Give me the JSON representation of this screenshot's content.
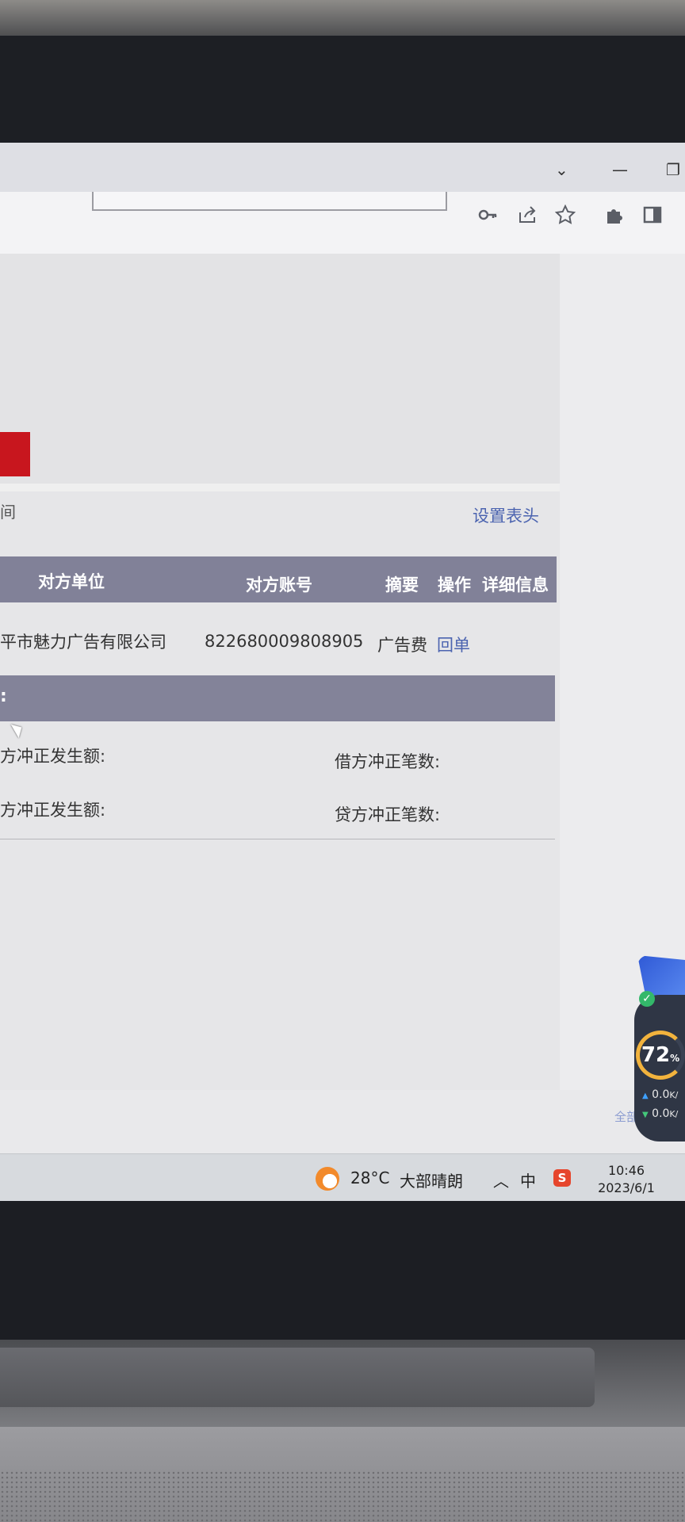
{
  "browser": {
    "window_controls": [
      "⌄",
      "—",
      "❐"
    ],
    "toolbar_icons": [
      "key-icon",
      "share-icon",
      "star-icon",
      "extensions-icon",
      "sidebar-icon"
    ]
  },
  "page": {
    "edge_text": "间",
    "set_header_link": "设置表头",
    "table": {
      "headers": [
        "对方单位",
        "对方账号",
        "摘要",
        "操作",
        "详细信息"
      ],
      "rows": [
        {
          "counterparty": "平市魅力广告有限公司",
          "account": "822680009808905",
          "summary": "广告费",
          "action": "回单"
        }
      ]
    },
    "summary_bar": ":",
    "stats": {
      "debit_amount_label": "方冲正发生额:",
      "debit_count_label": "借方冲正笔数:",
      "credit_amount_label": "方冲正发生额:",
      "credit_count_label": "贷方冲正笔数:"
    },
    "bottom_link": "全部"
  },
  "widget": {
    "percent": "72",
    "percent_unit": "%",
    "upload": "0.0",
    "download": "0.0",
    "speed_unit": "K/"
  },
  "taskbar": {
    "temperature": "28°C",
    "weather": "大部晴朗",
    "ime": "中",
    "ime_app": "S",
    "time": "10:46",
    "date": "2023/6/1"
  }
}
